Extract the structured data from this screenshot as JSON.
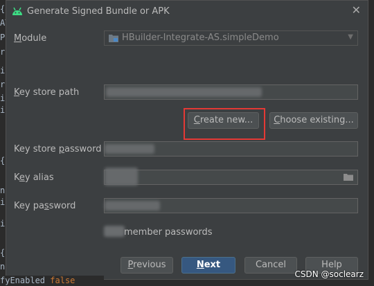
{
  "editor": {
    "left_fragments": [
      "{",
      "AT",
      "Pa",
      "re",
      "ie",
      "re",
      "ig",
      "ic",
      "{",
      "ni",
      "it",
      "ig",
      "{",
      "ni"
    ],
    "bottom_code_ident": "fyEnabled",
    "bottom_code_kw": "false"
  },
  "dialog": {
    "title": "Generate Signed Bundle or APK",
    "close_glyph": "✕"
  },
  "form": {
    "module_label_u": "M",
    "module_label_rest": "odule",
    "module_value": "HBuilder-Integrate-AS.simpleDemo",
    "keystore_path_label_u": "K",
    "keystore_path_label_rest": "ey store path",
    "create_new_u": "C",
    "create_new_rest": "reate new...",
    "choose_existing_u": "C",
    "choose_existing_rest": "hoose existing...",
    "keystore_password_label_pre": "Key store ",
    "keystore_password_label_u": "p",
    "keystore_password_label_rest": "assword",
    "key_alias_label_pre": "K",
    "key_alias_label_u": "e",
    "key_alias_label_rest": "y alias",
    "key_password_label_pre": "Key pa",
    "key_password_label_u": "s",
    "key_password_label_rest": "sword",
    "remember_text": "member passwords"
  },
  "footer": {
    "previous_u": "P",
    "previous_rest": "revious",
    "next_u": "N",
    "next_rest": "ext",
    "cancel": "Cancel",
    "help": "Help"
  },
  "watermark": "CSDN @soclearz",
  "colors": {
    "dialog_bg": "#3c3f41",
    "primary_button": "#365880",
    "highlight": "#e53935",
    "android_green": "#3ddc84"
  },
  "icons": {
    "android": "android-icon",
    "module": "module-folder-icon",
    "browse": "folder-icon",
    "dropdown": "chevron-down-icon"
  }
}
